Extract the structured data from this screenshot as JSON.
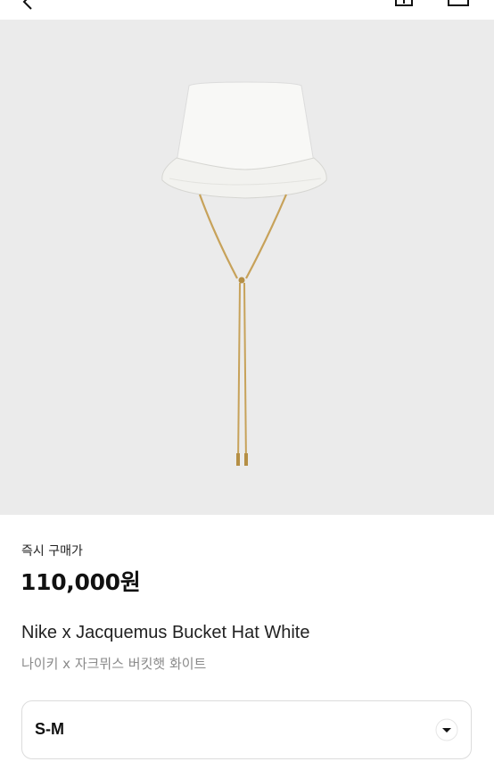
{
  "header": {
    "back_icon": "back-arrow-icon",
    "action_icons": [
      "share-icon",
      "menu-icon"
    ]
  },
  "product_image": {
    "alt": "white bucket hat with gold cord"
  },
  "purchase": {
    "label": "즉시 구매가",
    "price": "110,000원"
  },
  "product": {
    "name_en": "Nike x Jacquemus Bucket Hat White",
    "name_ko": "나이키 x 자크뮈스 버킷햇 화이트"
  },
  "size_select": {
    "value": "S-M",
    "icon": "chevron-down-icon"
  },
  "colors": {
    "image_bg": "#ebebeb",
    "hat": "#f7f7f5",
    "cord": "#c7a25a"
  }
}
